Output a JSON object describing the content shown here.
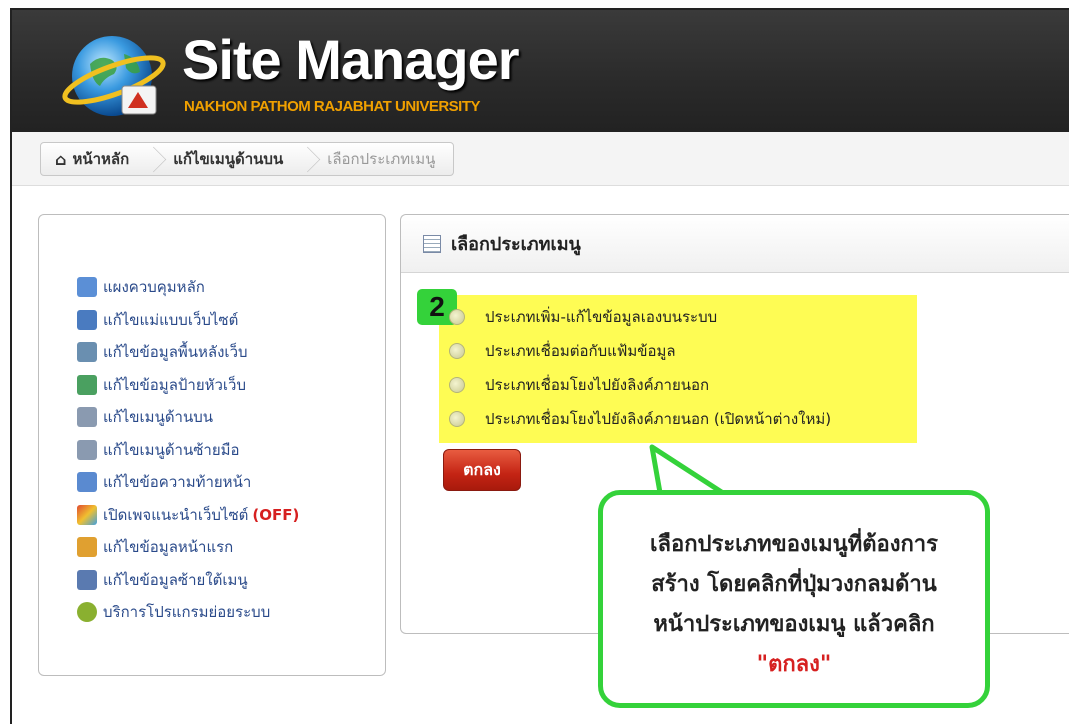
{
  "header": {
    "title": "Site Manager",
    "subtitle": "NAKHON PATHOM RAJABHAT UNIVERSITY"
  },
  "breadcrumb": [
    {
      "label": "หน้าหลัก",
      "icon": "home-icon"
    },
    {
      "label": "แก้ไขเมนูด้านบน"
    },
    {
      "label": "เลือกประเภทเมนู"
    }
  ],
  "sidebar": {
    "items": [
      {
        "label": "แผงควบคุมหลัก",
        "icon": "dashboard-icon",
        "color": "#5b8fd6"
      },
      {
        "label": "แก้ไขแม่แบบเว็บไซต์",
        "icon": "template-icon",
        "color": "#4a7bc0"
      },
      {
        "label": "แก้ไขข้อมูลพื้นหลังเว็บ",
        "icon": "background-icon",
        "color": "#6a8fb0"
      },
      {
        "label": "แก้ไขข้อมูลป้ายหัวเว็บ",
        "icon": "banner-icon",
        "color": "#4aa060"
      },
      {
        "label": "แก้ไขเมนูด้านบน",
        "icon": "top-menu-icon",
        "color": "#8a9ab0"
      },
      {
        "label": "แก้ไขเมนูด้านซ้ายมือ",
        "icon": "left-menu-icon",
        "color": "#8a9ab0"
      },
      {
        "label": "แก้ไขข้อความท้ายหน้า",
        "icon": "footer-icon",
        "color": "#5a8ad0"
      },
      {
        "label": "เปิดเพจแนะนำเว็บไซต์",
        "suffix": "(OFF)",
        "icon": "intro-page-icon",
        "color": "#d06a40"
      },
      {
        "label": "แก้ไขข้อมูลหน้าแรก",
        "icon": "home-page-icon",
        "color": "#e0a030"
      },
      {
        "label": "แก้ไขข้อมูลซ้ายใต้เมนู",
        "icon": "left-under-menu-icon",
        "color": "#5a7ab0"
      },
      {
        "label": "บริการโปรแกรมย่อยระบบ",
        "icon": "package-icon",
        "color": "#8ab030"
      }
    ]
  },
  "panel": {
    "title": "เลือกประเภทเมนู",
    "step_number": "2",
    "options": [
      "ประเภทเพิ่ม-แก้ไขข้อมูลเองบนระบบ",
      "ประเภทเชื่อมต่อกับแฟ้มข้อมูล",
      "ประเภทเชื่อมโยงไปยังลิงค์ภายนอก",
      "ประเภทเชื่อมโยงไปยังลิงค์ภายนอก (เปิดหน้าต่างใหม่)"
    ],
    "ok_label": "ตกลง"
  },
  "callout": {
    "lines": [
      "เลือกประเภทของเมนูที่ต้องการ",
      "สร้าง โดยคลิกที่ปุ่มวงกลมด้าน",
      "หน้าประเภทของเมนู แล้วคลิก"
    ],
    "emphasis": "\"ตกลง\""
  },
  "colors": {
    "header_bg": "#2a2a2a",
    "subtitle": "#f0a000",
    "highlight": "#fefc54",
    "callout_border": "#34d23a",
    "ok_button": "#c42414",
    "link": "#2a4a8a"
  }
}
